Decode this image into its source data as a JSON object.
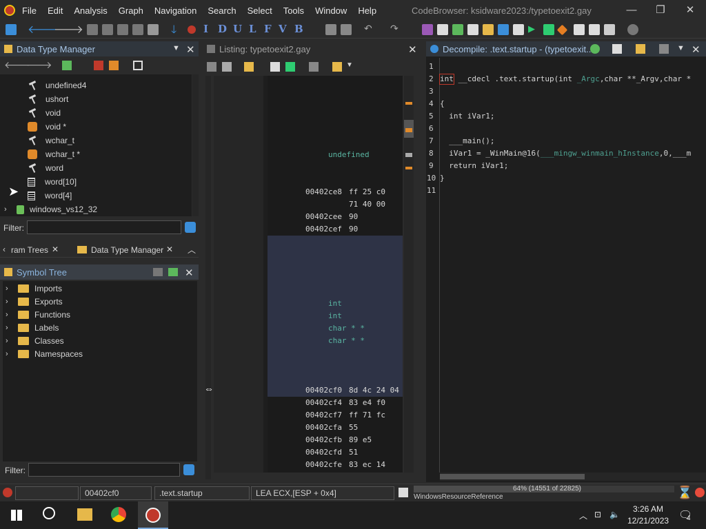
{
  "window": {
    "title": "CodeBrowser: ksidware2023:/typetoexit2.gay",
    "menu": [
      "File",
      "Edit",
      "Analysis",
      "Graph",
      "Navigation",
      "Search",
      "Select",
      "Tools",
      "Window",
      "Help"
    ]
  },
  "toolbar": {
    "letters": [
      "I",
      "D",
      "U",
      "L",
      "F",
      "V",
      "B"
    ]
  },
  "data_type_manager": {
    "title": "Data Type Manager",
    "items": [
      {
        "label": "undefined4",
        "icon": "hammer-icon"
      },
      {
        "label": "ushort",
        "icon": "hammer-icon"
      },
      {
        "label": "void",
        "icon": "hammer-icon"
      },
      {
        "label": "void *",
        "icon": "pointer-icon"
      },
      {
        "label": "wchar_t",
        "icon": "hammer-icon"
      },
      {
        "label": "wchar_t *",
        "icon": "pointer-icon"
      },
      {
        "label": "word",
        "icon": "hammer-icon"
      },
      {
        "label": "word[10]",
        "icon": "array-icon"
      },
      {
        "label": "word[4]",
        "icon": "array-icon"
      }
    ],
    "archive": "windows_vs12_32",
    "filter_label": "Filter:"
  },
  "tabs": {
    "program_trees": "ram Trees",
    "data_type_manager": "Data Type Manager"
  },
  "symbol_tree": {
    "title": "Symbol Tree",
    "items": [
      "Imports",
      "Exports",
      "Functions",
      "Labels",
      "Classes",
      "Namespaces"
    ],
    "filter_label": "Filter:"
  },
  "listing": {
    "title": "Listing:  typetoexit2.gay",
    "type_rows": [
      "undefined",
      "int",
      "int",
      "char * *",
      "char * *"
    ],
    "rows": [
      {
        "addr": "00402ce8",
        "bytes": "ff 25 c0"
      },
      {
        "addr": "",
        "bytes": "71 40 00"
      },
      {
        "addr": "00402cee",
        "bytes": "90"
      },
      {
        "addr": "00402cef",
        "bytes": "90"
      },
      {
        "addr": "00402cf0",
        "bytes": "8d 4c 24 04"
      },
      {
        "addr": "00402cf4",
        "bytes": "83 e4 f0"
      },
      {
        "addr": "00402cf7",
        "bytes": "ff 71 fc"
      },
      {
        "addr": "00402cfa",
        "bytes": "55"
      },
      {
        "addr": "00402cfb",
        "bytes": "89 e5"
      },
      {
        "addr": "00402cfd",
        "bytes": "51"
      },
      {
        "addr": "00402cfe",
        "bytes": "83 ec 14"
      }
    ]
  },
  "decompile": {
    "title": "Decompile: .text.startup -  (typetoexit...",
    "lines": [
      {
        "n": "1",
        "pre": "",
        "g": "",
        "post": ""
      },
      {
        "n": "2",
        "pre": "int __cdecl .text.startup(int ",
        "g": "_Argc",
        "post": ",char **_Argv,char *"
      },
      {
        "n": "3",
        "pre": "",
        "g": "",
        "post": ""
      },
      {
        "n": "4",
        "pre": "{",
        "g": "",
        "post": ""
      },
      {
        "n": "5",
        "pre": "  int iVar1;",
        "g": "",
        "post": ""
      },
      {
        "n": "6",
        "pre": "",
        "g": "",
        "post": ""
      },
      {
        "n": "7",
        "pre": "  ___main();",
        "g": "",
        "post": ""
      },
      {
        "n": "8",
        "pre": "  iVar1 = _WinMain@16(",
        "g": "___mingw_winmain_hInstance",
        "post": ",0,___m"
      },
      {
        "n": "9",
        "pre": "  return iVar1;",
        "g": "",
        "post": ""
      },
      {
        "n": "10",
        "pre": "}",
        "g": "",
        "post": ""
      },
      {
        "n": "11",
        "pre": "",
        "g": "",
        "post": ""
      }
    ]
  },
  "status": {
    "address": "00402cf0",
    "function": ".text.startup",
    "instruction": "LEA ECX,[ESP + 0x4]",
    "reference": "WindowsResourceReference",
    "memory": "64% (14551 of 22825)",
    "memory_fraction": 0.64
  },
  "taskbar": {
    "time": "3:26 AM",
    "date": "12/21/2023",
    "notifications": "4"
  },
  "colors": {
    "accent": "#a9c7e8",
    "code_green": "#5ab5a2",
    "highlight": "#2e3346"
  }
}
